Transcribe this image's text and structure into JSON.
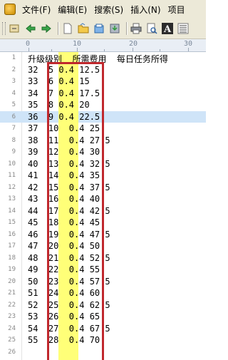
{
  "menu": {
    "items": [
      "文件(F)",
      "编辑(E)",
      "搜索(S)",
      "插入(N)",
      "项目"
    ]
  },
  "toolbar": {
    "icons": [
      "undo-icon",
      "back-arrow-icon",
      "forward-arrow-icon",
      "new-file-icon",
      "open-folder-icon",
      "open-file-icon",
      "save-icon",
      "print-icon",
      "preview-icon",
      "font-icon",
      "list-icon"
    ]
  },
  "ruler": {
    "labels": [
      "0",
      "10",
      "20",
      "30"
    ]
  },
  "editor": {
    "current_line": 6,
    "lines": [
      {
        "n": "1",
        "text": "升级级别  所需费用  每日任务所得"
      },
      {
        "n": "2",
        "text": "32  5 0.4 12.5"
      },
      {
        "n": "3",
        "text": "33  6 0.4 15"
      },
      {
        "n": "4",
        "text": "34  7 0.4 17.5"
      },
      {
        "n": "5",
        "text": "35  8 0.4 20"
      },
      {
        "n": "6",
        "text": "36  9 0.4 22.5"
      },
      {
        "n": "7",
        "text": "37  10  0.4 25"
      },
      {
        "n": "8",
        "text": "38  11  0.4 27.5"
      },
      {
        "n": "9",
        "text": "39  12  0.4 30"
      },
      {
        "n": "10",
        "text": "40  13  0.4 32.5"
      },
      {
        "n": "11",
        "text": "41  14  0.4 35"
      },
      {
        "n": "12",
        "text": "42  15  0.4 37.5"
      },
      {
        "n": "13",
        "text": "43  16  0.4 40"
      },
      {
        "n": "14",
        "text": "44  17  0.4 42.5"
      },
      {
        "n": "15",
        "text": "45  18  0.4 45"
      },
      {
        "n": "16",
        "text": "46  19  0.4 47.5"
      },
      {
        "n": "17",
        "text": "47  20  0.4 50"
      },
      {
        "n": "18",
        "text": "48  21  0.4 52.5"
      },
      {
        "n": "19",
        "text": "49  22  0.4 55"
      },
      {
        "n": "20",
        "text": "50  23  0.4 57.5"
      },
      {
        "n": "21",
        "text": "51  24  0.4 60"
      },
      {
        "n": "22",
        "text": "52  25  0.4 62.5"
      },
      {
        "n": "23",
        "text": "53  26  0.4 65"
      },
      {
        "n": "24",
        "text": "54  27  0.4 67.5"
      },
      {
        "n": "25",
        "text": "55  28  0.4 70"
      },
      {
        "n": "26",
        "text": ""
      }
    ]
  },
  "colors": {
    "highlight_column": "#ffff78",
    "current_line": "#cfe4f8",
    "annotation_box": "#c0282d"
  }
}
